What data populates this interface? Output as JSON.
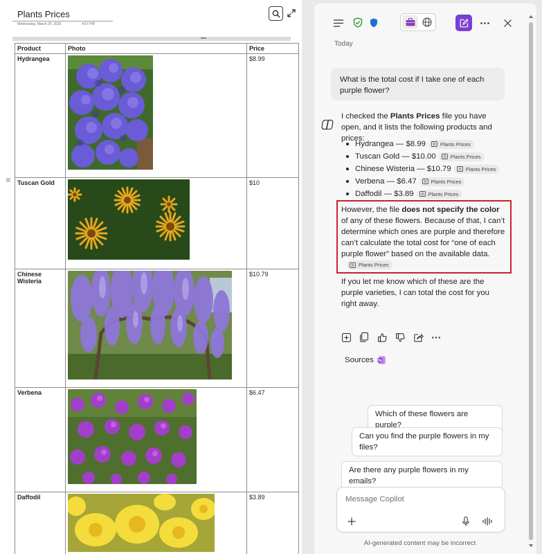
{
  "document": {
    "title": "Plants Prices",
    "date": "Wednesday, March 25, 2026",
    "time": "4:57 PM",
    "table": {
      "headers": [
        "Product",
        "Photo",
        "Price"
      ],
      "rows": [
        {
          "product": "Hydrangea",
          "price": "$8.99",
          "photo": "hydrangea-photo"
        },
        {
          "product": "Tuscan Gold",
          "price": "$10",
          "photo": "tuscan-gold-photo"
        },
        {
          "product": "Chinese Wisteria",
          "price": "$10.79",
          "photo": "wisteria-photo"
        },
        {
          "product": "Verbena",
          "price": "$6.47",
          "photo": "verbena-photo"
        },
        {
          "product": "Daffodil",
          "price": "$3.89",
          "photo": "daffodil-photo"
        }
      ]
    }
  },
  "copilot": {
    "header_icons": [
      "menu-icon",
      "shield-check-icon",
      "shield-icon",
      "briefcase-icon",
      "globe-icon",
      "new-chat-icon",
      "more-icon",
      "close-icon"
    ],
    "today_label": "Today",
    "user_message": "What is the total cost if I take one of each purple flower?",
    "response": {
      "intro_1": "I checked the ",
      "intro_bold": "Plants Prices",
      "intro_2": " file you have open, and it lists the following products and prices:",
      "items": [
        {
          "text": "Hydrangea — $8.99",
          "cite": "Plants Prices"
        },
        {
          "text": "Tuscan Gold — $10.00",
          "cite": "Plants Prices"
        },
        {
          "text": "Chinese Wisteria — $10.79",
          "cite": "Plants Prices"
        },
        {
          "text": "Verbena — $6.47",
          "cite": "Plants Prices"
        },
        {
          "text": "Daffodil — $3.89",
          "cite": "Plants Prices"
        }
      ],
      "p2_1": "However, the file ",
      "p2_bold": "does not specify the color",
      "p2_2": " of any of these flowers. Because of that, I can’t determine which ones are purple and therefore can’t calculate the total cost for “one of each purple flower” based on the available data.",
      "p2_cite": "Plants Prices",
      "p3": "If you let me know which of these are the purple varieties, I can total the cost for you right away."
    },
    "actions": [
      "add-icon",
      "copy-icon",
      "thumbs-up-icon",
      "thumbs-down-icon",
      "share-icon",
      "more-icon"
    ],
    "sources_label": "Sources",
    "suggestions": [
      "Which of these flowers are purple?",
      "Can you find the purple flowers in my files?",
      "Are there any purple flowers in my emails?"
    ],
    "composer": {
      "placeholder": "Message Copilot"
    },
    "disclaimer": "AI-generated content may be incorrect"
  },
  "colors": {
    "accent": "#7b3fd1",
    "highlight": "#c8232c",
    "shield_green": "#2e8b3a",
    "shield_blue": "#1f6fd6"
  }
}
